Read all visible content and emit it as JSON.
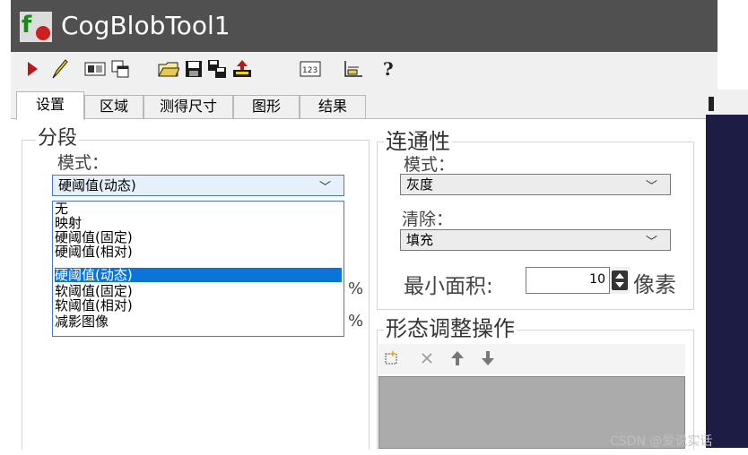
{
  "window": {
    "title": "CogBlobTool1"
  },
  "toolbar": {
    "icons": [
      "run-icon",
      "edit-icon",
      "image-display-icon",
      "copy-windows-icon",
      "open-folder-icon",
      "save-icon",
      "save-with-image-icon",
      "load-icon",
      "counter-123-icon",
      "results-graph-icon",
      "help-icon"
    ]
  },
  "tabs": [
    "设置",
    "区域",
    "测得尺寸",
    "图形",
    "结果"
  ],
  "segmentation": {
    "legend": "分段",
    "mode_label": "模式：",
    "mode_value": "硬阈值(动态)",
    "options": [
      "无",
      "映射",
      "硬阈值(固定)",
      "硬阈值(相对)",
      "硬阈值(动态)",
      "软阈值(固定)",
      "软阈值(相对)",
      "减影图像"
    ],
    "selected_index": 4,
    "percent_1": "%",
    "percent_2": "%"
  },
  "connectivity": {
    "legend": "连通性",
    "mode_label": "模式：",
    "mode_value": "灰度",
    "cleanup_label": "清除：",
    "cleanup_value": "填充",
    "min_area_label": "最小面积:",
    "min_area_value": "10",
    "min_area_unit": "像素"
  },
  "morphology": {
    "legend": "形态调整操作"
  },
  "watermark": "CSDN @爱说实话"
}
